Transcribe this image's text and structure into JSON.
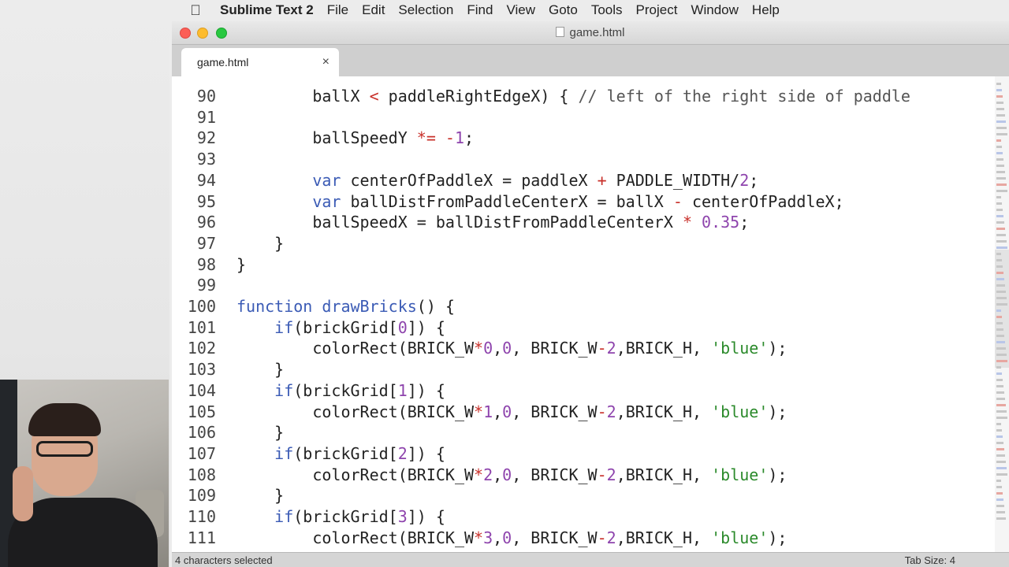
{
  "menubar": {
    "app_name": "Sublime Text 2",
    "items": [
      "File",
      "Edit",
      "Selection",
      "Find",
      "View",
      "Goto",
      "Tools",
      "Project",
      "Window",
      "Help"
    ]
  },
  "window": {
    "title": "game.html"
  },
  "tab": {
    "label": "game.html",
    "close_glyph": "×"
  },
  "code_lines": [
    {
      "num": "90",
      "tokens": [
        [
          "",
          "        ballX "
        ],
        [
          "op",
          "<"
        ],
        [
          "",
          " paddleRightEdgeX) { "
        ],
        [
          "cmt",
          "// left of the right side of paddle"
        ]
      ]
    },
    {
      "num": "91",
      "tokens": []
    },
    {
      "num": "92",
      "tokens": [
        [
          "",
          "        ballSpeedY "
        ],
        [
          "op",
          "*="
        ],
        [
          "",
          " "
        ],
        [
          "op",
          "-"
        ],
        [
          "num",
          "1"
        ],
        [
          "",
          ";"
        ]
      ]
    },
    {
      "num": "93",
      "tokens": []
    },
    {
      "num": "94",
      "tokens": [
        [
          "",
          "        "
        ],
        [
          "kw",
          "var"
        ],
        [
          "",
          " centerOfPaddleX = paddleX "
        ],
        [
          "op",
          "+"
        ],
        [
          "",
          " PADDLE_WIDTH/"
        ],
        [
          "num",
          "2"
        ],
        [
          "",
          ";"
        ]
      ]
    },
    {
      "num": "95",
      "tokens": [
        [
          "",
          "        "
        ],
        [
          "kw",
          "var"
        ],
        [
          "",
          " ballDistFromPaddleCenterX = ballX "
        ],
        [
          "op",
          "-"
        ],
        [
          "",
          " centerOfPaddleX;"
        ]
      ]
    },
    {
      "num": "96",
      "tokens": [
        [
          "",
          "        ballSpeedX = ballDistFromPaddleCenterX "
        ],
        [
          "op",
          "*"
        ],
        [
          "",
          " "
        ],
        [
          "num",
          "0.35"
        ],
        [
          "",
          ";"
        ]
      ]
    },
    {
      "num": "97",
      "tokens": [
        [
          "",
          "    }"
        ]
      ]
    },
    {
      "num": "98",
      "tokens": [
        [
          "",
          "}"
        ]
      ]
    },
    {
      "num": "99",
      "tokens": []
    },
    {
      "num": "100",
      "tokens": [
        [
          "kw",
          "function"
        ],
        [
          "",
          " "
        ],
        [
          "kw",
          "drawBricks"
        ],
        [
          "",
          "() {"
        ]
      ]
    },
    {
      "num": "101",
      "tokens": [
        [
          "",
          "    "
        ],
        [
          "kw",
          "if"
        ],
        [
          "",
          "(brickGrid["
        ],
        [
          "num",
          "0"
        ],
        [
          "",
          "]) {"
        ]
      ]
    },
    {
      "num": "102",
      "tokens": [
        [
          "",
          "        colorRect(BRICK_W"
        ],
        [
          "op",
          "*"
        ],
        [
          "num",
          "0"
        ],
        [
          "",
          ","
        ],
        [
          "num",
          "0"
        ],
        [
          "",
          ", BRICK_W"
        ],
        [
          "op",
          "-"
        ],
        [
          "num",
          "2"
        ],
        [
          "",
          ",BRICK_H, "
        ],
        [
          "str",
          "'blue'"
        ],
        [
          "",
          ");"
        ]
      ]
    },
    {
      "num": "103",
      "tokens": [
        [
          "",
          "    }"
        ]
      ]
    },
    {
      "num": "104",
      "tokens": [
        [
          "",
          "    "
        ],
        [
          "kw",
          "if"
        ],
        [
          "",
          "(brickGrid["
        ],
        [
          "num",
          "1"
        ],
        [
          "",
          "]) {"
        ]
      ]
    },
    {
      "num": "105",
      "tokens": [
        [
          "",
          "        colorRect(BRICK_W"
        ],
        [
          "op",
          "*"
        ],
        [
          "num",
          "1"
        ],
        [
          "",
          ","
        ],
        [
          "num",
          "0"
        ],
        [
          "",
          ", BRICK_W"
        ],
        [
          "op",
          "-"
        ],
        [
          "num",
          "2"
        ],
        [
          "",
          ",BRICK_H, "
        ],
        [
          "str",
          "'blue'"
        ],
        [
          "",
          ");"
        ]
      ]
    },
    {
      "num": "106",
      "tokens": [
        [
          "",
          "    }"
        ]
      ]
    },
    {
      "num": "107",
      "tokens": [
        [
          "",
          "    "
        ],
        [
          "kw",
          "if"
        ],
        [
          "",
          "(brickGrid["
        ],
        [
          "num",
          "2"
        ],
        [
          "",
          "]) {"
        ]
      ]
    },
    {
      "num": "108",
      "tokens": [
        [
          "",
          "        colorRect(BRICK_W"
        ],
        [
          "op",
          "*"
        ],
        [
          "num",
          "2"
        ],
        [
          "",
          ","
        ],
        [
          "num",
          "0"
        ],
        [
          "",
          ", BRICK_W"
        ],
        [
          "op",
          "-"
        ],
        [
          "num",
          "2"
        ],
        [
          "",
          ",BRICK_H, "
        ],
        [
          "str",
          "'blue'"
        ],
        [
          "",
          ");"
        ]
      ]
    },
    {
      "num": "109",
      "tokens": [
        [
          "",
          "    }"
        ]
      ]
    },
    {
      "num": "110",
      "tokens": [
        [
          "",
          "    "
        ],
        [
          "kw",
          "if"
        ],
        [
          "",
          "(brickGrid["
        ],
        [
          "num",
          "3"
        ],
        [
          "",
          "]) {"
        ]
      ]
    },
    {
      "num": "111",
      "tokens": [
        [
          "",
          "        colorRect(BRICK_W"
        ],
        [
          "op",
          "*"
        ],
        [
          "num",
          "3"
        ],
        [
          "",
          ","
        ],
        [
          "num",
          "0"
        ],
        [
          "",
          ", BRICK_W"
        ],
        [
          "op",
          "-"
        ],
        [
          "num",
          "2"
        ],
        [
          "",
          ",BRICK_H, "
        ],
        [
          "str",
          "'blue'"
        ],
        [
          "",
          ");"
        ]
      ]
    }
  ],
  "statusbar": {
    "selection": "4 characters selected",
    "tab_size": "Tab Size: 4"
  },
  "colors": {
    "keyword": "#3b5bb5",
    "operator": "#c8302a",
    "number": "#8e44ad",
    "string": "#2b8a2b"
  },
  "icons": {
    "apple": "apple-logo-icon",
    "doc": "document-icon"
  }
}
